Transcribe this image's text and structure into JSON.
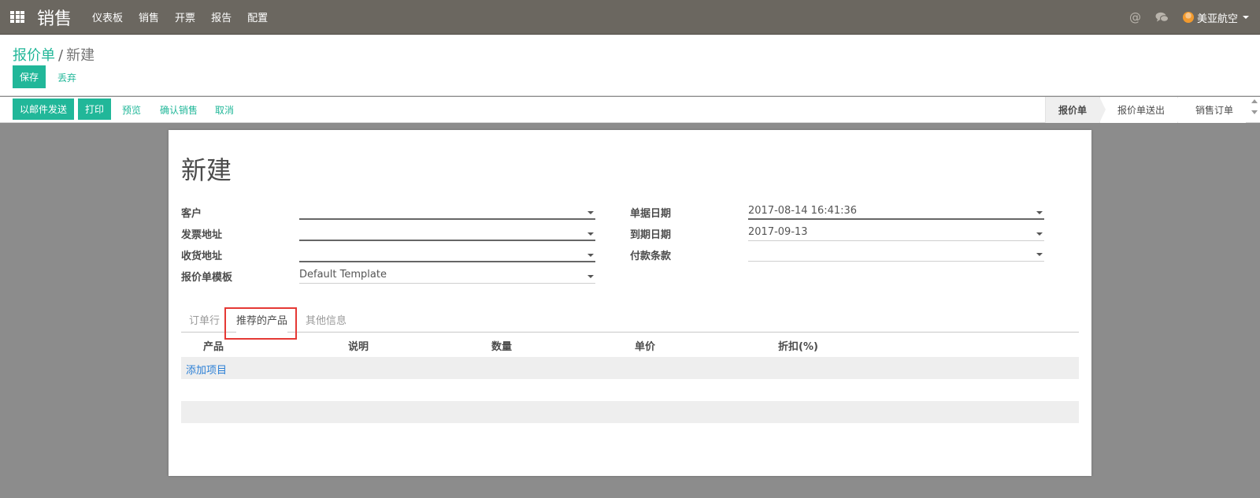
{
  "navbar": {
    "brand": "销售",
    "menu": [
      "仪表板",
      "销售",
      "开票",
      "报告",
      "配置"
    ],
    "user": "美亚航空",
    "at_symbol": "@"
  },
  "breadcrumb": {
    "parent": "报价单",
    "separator": "/",
    "current": "新建"
  },
  "buttons": {
    "save": "保存",
    "discard": "丢弃",
    "send_email": "以邮件发送",
    "print": "打印",
    "preview": "预览",
    "confirm_sale": "确认销售",
    "cancel": "取消"
  },
  "stages": [
    "报价单",
    "报价单送出",
    "销售订单"
  ],
  "active_stage": "报价单",
  "form": {
    "title": "新建",
    "left_fields": [
      {
        "label": "客户",
        "value": ""
      },
      {
        "label": "发票地址",
        "value": ""
      },
      {
        "label": "收货地址",
        "value": ""
      },
      {
        "label": "报价单模板",
        "value": "Default Template"
      }
    ],
    "right_fields": [
      {
        "label": "单据日期",
        "value": "2017-08-14 16:41:36"
      },
      {
        "label": "到期日期",
        "value": "2017-09-13"
      },
      {
        "label": "付款条款",
        "value": ""
      }
    ]
  },
  "tabs": [
    "订单行",
    "推荐的产品",
    "其他信息"
  ],
  "active_tab": "推荐的产品",
  "table": {
    "columns": [
      "产品",
      "说明",
      "数量",
      "单价",
      "折扣(%)"
    ],
    "add_item": "添加项目"
  },
  "colors": {
    "navbar_bg": "#6b6760",
    "accent": "#21b799",
    "link_blue": "#2a7fd6",
    "highlight_red": "#e53935"
  }
}
